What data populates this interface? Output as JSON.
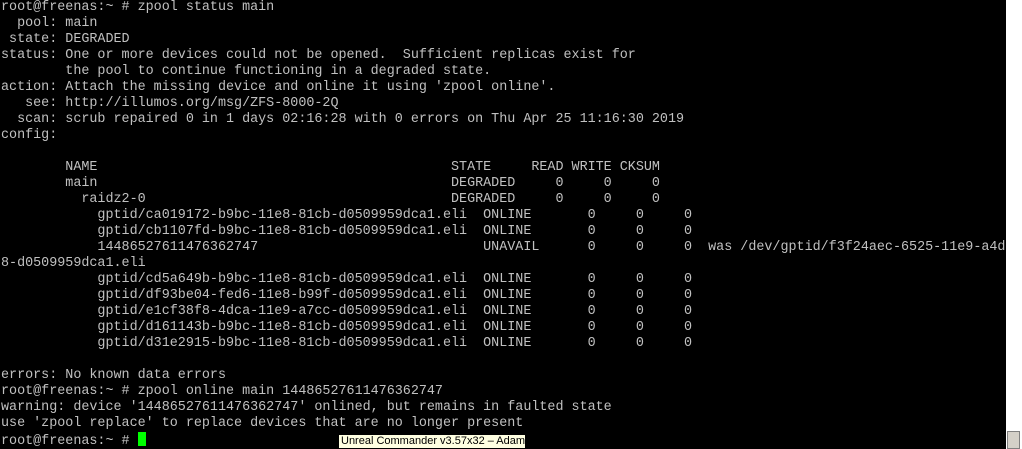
{
  "terminal": {
    "lines": [
      "root@freenas:~ # zpool status main",
      "  pool: main",
      " state: DEGRADED",
      "status: One or more devices could not be opened.  Sufficient replicas exist for",
      "        the pool to continue functioning in a degraded state.",
      "action: Attach the missing device and online it using 'zpool online'.",
      "   see: http://illumos.org/msg/ZFS-8000-2Q",
      "  scan: scrub repaired 0 in 1 days 02:16:28 with 0 errors on Thu Apr 25 11:16:30 2019",
      "config:",
      "",
      "        NAME                                            STATE     READ WRITE CKSUM",
      "        main                                            DEGRADED     0     0     0",
      "          raidz2-0                                      DEGRADED     0     0     0",
      "            gptid/ca019172-b9bc-11e8-81cb-d0509959dca1.eli  ONLINE       0     0     0",
      "            gptid/cb1107fd-b9bc-11e8-81cb-d0509959dca1.eli  ONLINE       0     0     0",
      "            14486527611476362747                            UNAVAIL      0     0     0  was /dev/gptid/f3f24aec-6525-11e9-a4d",
      "8-d0509959dca1.eli",
      "            gptid/cd5a649b-b9bc-11e8-81cb-d0509959dca1.eli  ONLINE       0     0     0",
      "            gptid/df93be04-fed6-11e8-b99f-d0509959dca1.eli  ONLINE       0     0     0",
      "            gptid/e1cf38f8-4dca-11e9-a7cc-d0509959dca1.eli  ONLINE       0     0     0",
      "            gptid/d161143b-b9bc-11e8-81cb-d0509959dca1.eli  ONLINE       0     0     0",
      "            gptid/d31e2915-b9bc-11e8-81cb-d0509959dca1.eli  ONLINE       0     0     0",
      "",
      "errors: No known data errors",
      "root@freenas:~ # zpool online main 14486527611476362747",
      "warning: device '14486527611476362747' onlined, but remains in faulted state",
      "use 'zpool replace' to replace devices that are no longer present"
    ],
    "prompt": "root@freenas:~ # "
  },
  "tooltip": {
    "text": "Unreal Commander v3.57x32 – Adam"
  },
  "colors": {
    "background": "#000000",
    "text": "#c0c0c0",
    "cursor": "#00ff00"
  }
}
